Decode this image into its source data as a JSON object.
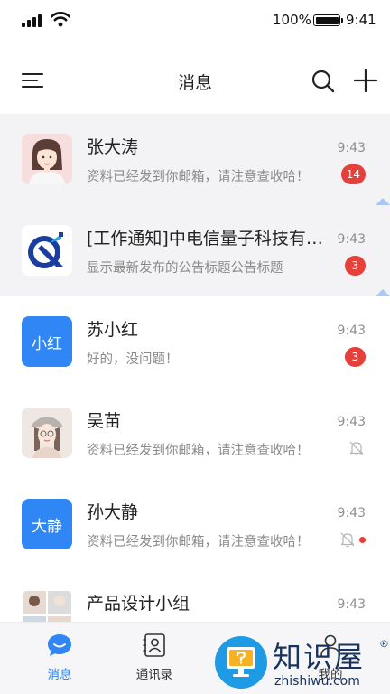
{
  "status_bar": {
    "battery_percent": "100%",
    "time": "9:41"
  },
  "nav": {
    "title": "消息",
    "menu_icon": "menu-icon",
    "search_icon": "search-icon",
    "add_icon": "plus-icon"
  },
  "conversations": [
    {
      "name": "张大涛",
      "preview": "资料已经发到你邮箱，请注意查收哈！",
      "time": "9:43",
      "badge": "14",
      "pinned": true,
      "avatar": "photo-avatar-woman"
    },
    {
      "name": "[工作通知]中电信量子科技有限公司",
      "preview": "显示最新发布的公告标题公告标题",
      "time": "9:43",
      "badge": "3",
      "pinned": true,
      "avatar": "company-logo"
    },
    {
      "name": "苏小红",
      "preview": "好的，没问题！",
      "time": "9:43",
      "badge": "3",
      "avatar_text": "小红"
    },
    {
      "name": "吴苗",
      "preview": "资料已经发到你邮箱，请注意查收哈！",
      "time": "9:43",
      "muted": true,
      "avatar": "photo-avatar-girl"
    },
    {
      "name": "孙大静",
      "preview": "资料已经发到你邮箱，请注意查收哈！",
      "time": "9:43",
      "muted": true,
      "unread_dot": true,
      "avatar_text": "大静"
    },
    {
      "name": "产品设计小组",
      "preview": "",
      "time": "9:43",
      "avatar": "group-avatar"
    }
  ],
  "tabs": [
    {
      "label": "消息",
      "icon": "chat-bubble-icon",
      "active": true
    },
    {
      "label": "通讯录",
      "icon": "contacts-icon"
    },
    {
      "label": "我的",
      "icon": "user-icon"
    }
  ],
  "watermark": {
    "text": "知识屋",
    "domain": "zhishiwu.com",
    "reg": "®"
  },
  "colors": {
    "accent": "#2f86f4",
    "badge": "#e5403a",
    "pinned_bg": "#f3f3f5"
  }
}
